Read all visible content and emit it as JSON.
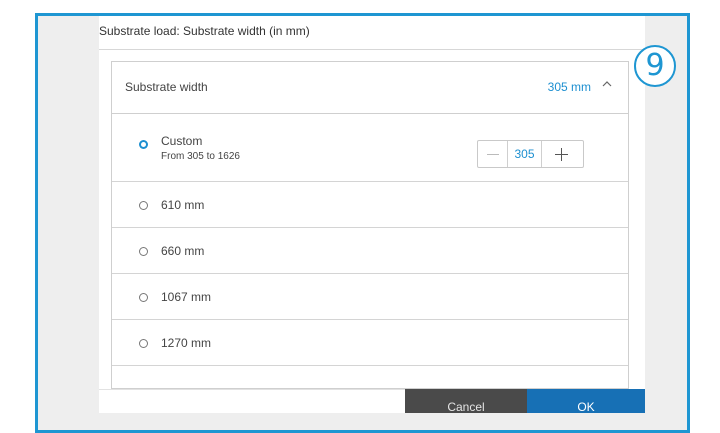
{
  "dialog": {
    "title": "Substrate load: Substrate width (in mm)"
  },
  "panel": {
    "header_label": "Substrate width",
    "header_value": "305 mm",
    "header_icon": "chevron-up-icon"
  },
  "options": [
    {
      "label": "Custom",
      "sublabel": "From 305 to 1626",
      "selected": true
    },
    {
      "label": "610 mm",
      "selected": false
    },
    {
      "label": "660 mm",
      "selected": false
    },
    {
      "label": "1067 mm",
      "selected": false
    },
    {
      "label": "1270 mm",
      "selected": false
    }
  ],
  "stepper": {
    "value": "305",
    "decrement_icon": "minus-icon",
    "increment_icon": "plus-icon"
  },
  "buttons": {
    "cancel": "Cancel",
    "ok": "OK"
  },
  "callout": {
    "number": "9"
  },
  "colors": {
    "accent": "#1e96d2",
    "value_text": "#1d8fd0",
    "ok_button": "#1770b5",
    "cancel_button": "#4a4a4a"
  }
}
